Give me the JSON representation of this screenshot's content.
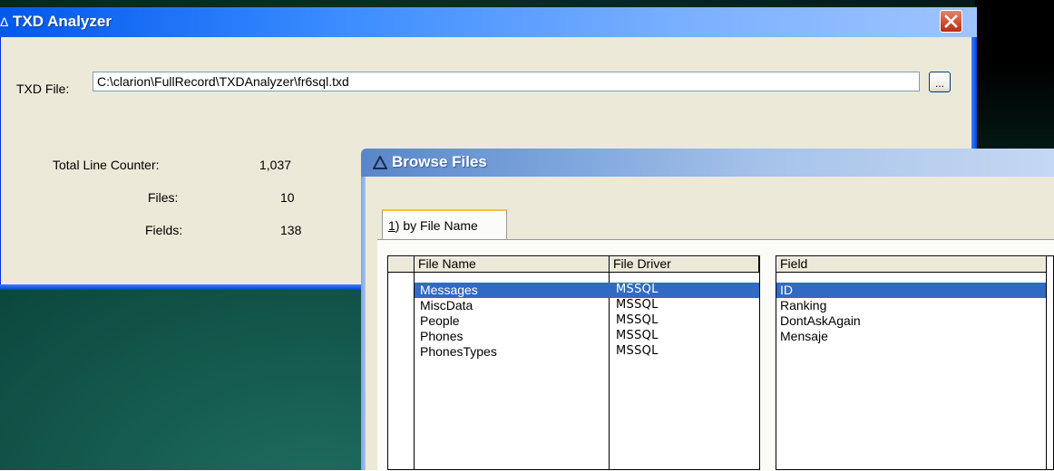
{
  "main_window": {
    "title": "TXD Analyzer",
    "title_icon": "Δ",
    "file_label": "TXD File:",
    "file_value": "C:\\clarion\\FullRecord\\TXDAnalyzer\\fr6sql.txd",
    "browse_label": "...",
    "stats": [
      {
        "label": "Total Line Counter:",
        "value": "1,037"
      },
      {
        "label": "Files:",
        "value": "10"
      },
      {
        "label": "Fields:",
        "value": "138"
      }
    ]
  },
  "browse_window": {
    "title": "Browse Files",
    "title_icon": "Δ",
    "tab": {
      "accel": "1",
      "rest": ") by File Name"
    },
    "files_table": {
      "headers": [
        "File Name",
        "File Driver"
      ],
      "rows": [
        {
          "name": "Messages",
          "driver": "MSSQL",
          "selected": true
        },
        {
          "name": "MiscData",
          "driver": "MSSQL",
          "selected": false
        },
        {
          "name": "People",
          "driver": "MSSQL",
          "selected": false
        },
        {
          "name": "Phones",
          "driver": "MSSQL",
          "selected": false
        },
        {
          "name": "PhonesTypes",
          "driver": "MSSQL",
          "selected": false
        }
      ]
    },
    "fields_table": {
      "header": "Field",
      "rows": [
        {
          "name": "ID",
          "selected": true
        },
        {
          "name": "Ranking",
          "selected": false
        },
        {
          "name": "DontAskAgain",
          "selected": false
        },
        {
          "name": "Mensaje",
          "selected": false
        }
      ]
    }
  },
  "colors": {
    "selection": "#316ac5",
    "xp_title_blue": "#0058ee",
    "inactive_title": "#7ea6dd",
    "dialog_bg": "#ece9d8"
  }
}
